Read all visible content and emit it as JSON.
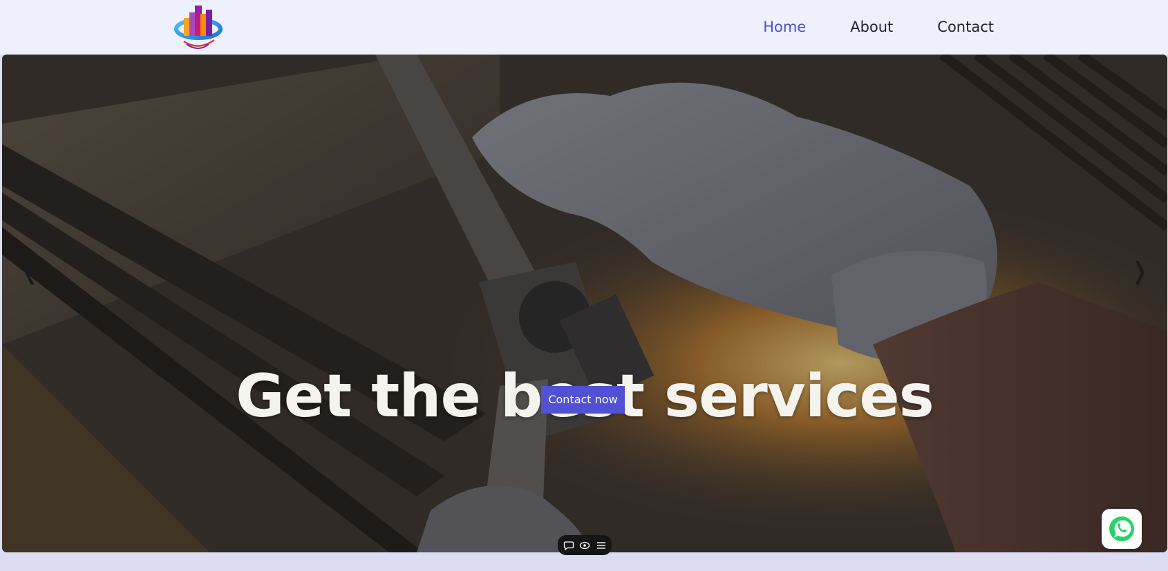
{
  "brand": {
    "logo_icon": "bar-chart-globe-logo-icon"
  },
  "nav": {
    "items": [
      {
        "label": "Home",
        "active": true
      },
      {
        "label": "About",
        "active": false
      },
      {
        "label": "Contact",
        "active": false
      }
    ]
  },
  "hero": {
    "headline": "Get the best services",
    "cta_label": "Contact now",
    "prev_arrow": "❬",
    "next_arrow": "❭",
    "background": "gloved-hand-wrench-photo"
  },
  "floating": {
    "whatsapp_icon": "whatsapp-icon",
    "toolbar_icons": [
      "chat-icon",
      "eye-icon",
      "menu-icon"
    ]
  },
  "colors": {
    "accent": "#5151d6",
    "nav_active": "#4f4fcf",
    "header_bg": "#eef0fc",
    "whatsapp": "#25d366"
  }
}
